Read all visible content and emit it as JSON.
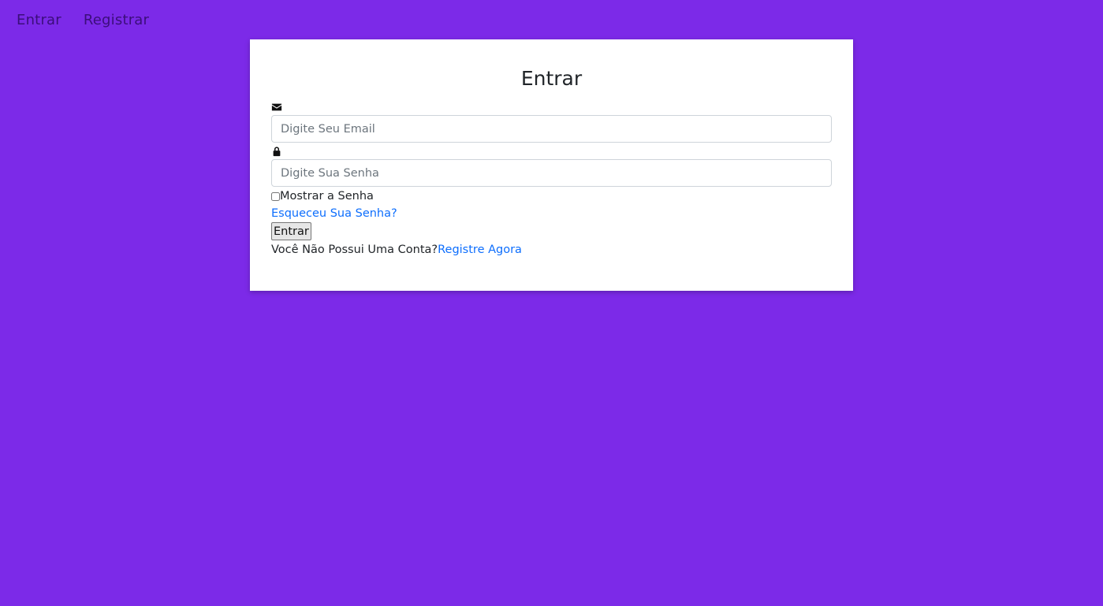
{
  "nav": {
    "items": [
      {
        "label": "Entrar"
      },
      {
        "label": "Registrar"
      }
    ]
  },
  "login": {
    "title": "Entrar",
    "email": {
      "icon": "envelope-icon",
      "placeholder": "Digite Seu Email",
      "value": ""
    },
    "password": {
      "icon": "lock-icon",
      "placeholder": "Digite Sua Senha",
      "value": ""
    },
    "show_password_label": "Mostrar a Senha",
    "forgot_link": "Esqueceu Sua Senha?",
    "submit_label": "Entrar",
    "no_account_text": "Você Não Possui Uma Conta?",
    "register_link": "Registre Agora"
  },
  "colors": {
    "background": "#7c2ae8",
    "card": "#ffffff",
    "link": "#0d6efd",
    "nav_text": "#3b0e7a"
  }
}
